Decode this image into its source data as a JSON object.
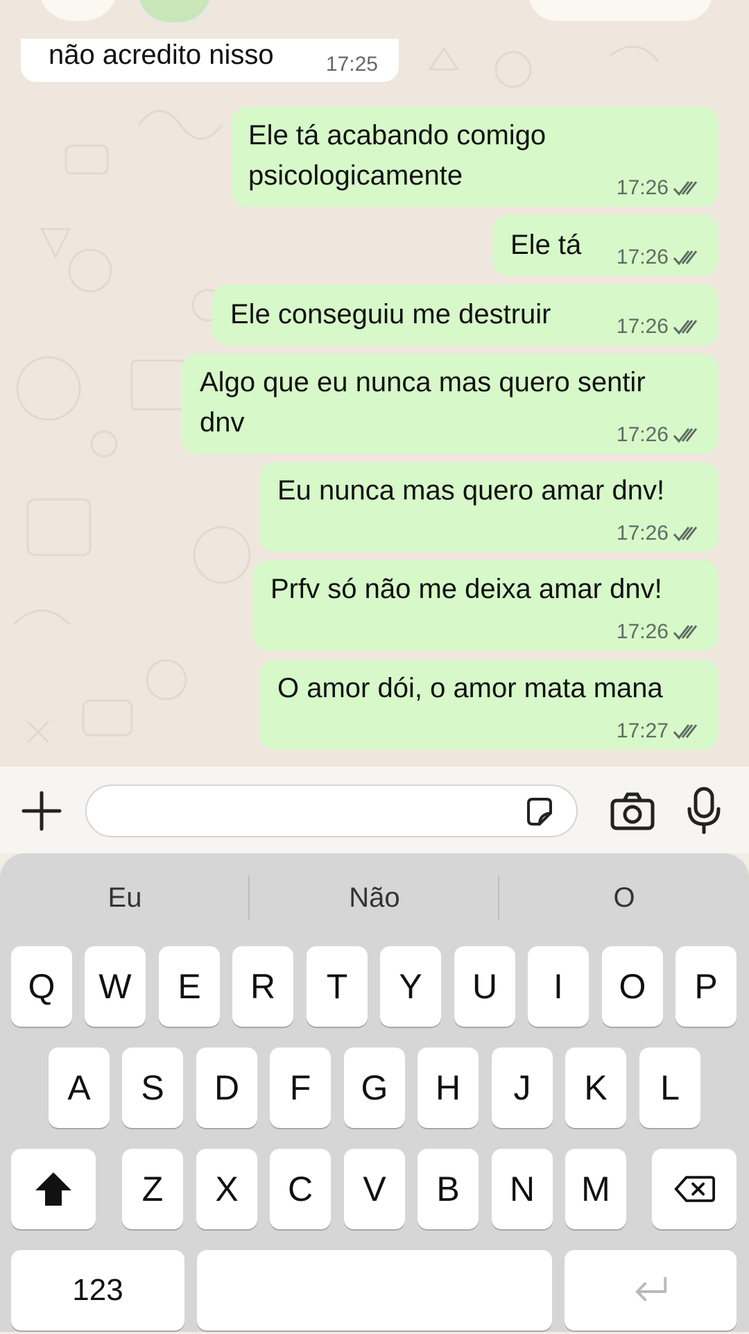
{
  "messages": [
    {
      "direction": "in",
      "lines": [
        "não acredito nisso"
      ],
      "time": "17:25"
    },
    {
      "direction": "out",
      "lines": [
        "Ele tá acabando comigo",
        "psicologicamente"
      ],
      "time": "17:26"
    },
    {
      "direction": "out",
      "lines": [
        "Ele tá"
      ],
      "time": "17:26"
    },
    {
      "direction": "out",
      "lines": [
        "Ele conseguiu me destruir"
      ],
      "time": "17:26"
    },
    {
      "direction": "out",
      "lines": [
        "Algo que eu nunca mas quero sentir",
        "dnv"
      ],
      "time": "17:26"
    },
    {
      "direction": "out",
      "lines": [
        "Eu nunca mas quero amar dnv!"
      ],
      "time": "17:26"
    },
    {
      "direction": "out",
      "lines": [
        "Prfv só não me deixa amar dnv!"
      ],
      "time": "17:26"
    },
    {
      "direction": "out",
      "lines": [
        "O amor dói, o amor mata mana"
      ],
      "time": "17:27"
    }
  ],
  "colors": {
    "incoming": "#ffffff",
    "outgoing": "#d7f8c9",
    "read_ticks": "#5f6b63"
  },
  "input": {
    "placeholder": ""
  },
  "suggestions": [
    "Eu",
    "Não",
    "O"
  ],
  "keyboard": {
    "row1": [
      "Q",
      "W",
      "E",
      "R",
      "T",
      "Y",
      "U",
      "I",
      "O",
      "P"
    ],
    "row2": [
      "A",
      "S",
      "D",
      "F",
      "G",
      "H",
      "J",
      "K",
      "L"
    ],
    "row3": [
      "Z",
      "X",
      "C",
      "V",
      "B",
      "N",
      "M"
    ],
    "numbers_label": "123"
  },
  "icons": {
    "plus": "plus-icon",
    "sticker": "sticker-icon",
    "camera": "camera-icon",
    "mic": "microphone-icon",
    "shift": "shift-icon",
    "backspace": "backspace-icon",
    "return": "return-icon"
  }
}
